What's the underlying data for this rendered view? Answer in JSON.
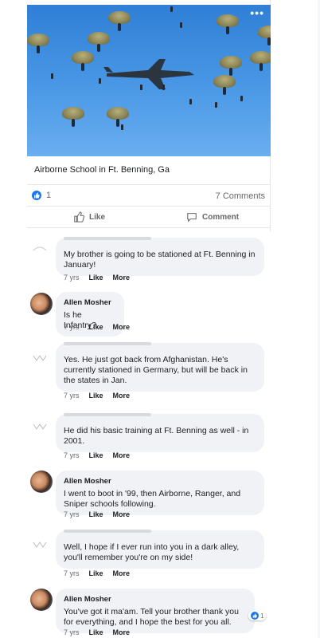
{
  "post": {
    "menu_glyph": "•••",
    "caption": "Airborne School in Ft. Benning, Ga",
    "like_count": "1",
    "comments_count": "7 Comments",
    "like_label": "Like",
    "comment_label": "Comment"
  },
  "comments": [
    {
      "author": "",
      "text": "My brother is going to be stationed at Ft. Benning in January!",
      "time": "7 yrs",
      "like": "Like",
      "more": "More"
    },
    {
      "author": "Allen Mosher",
      "text": "Is he Infantry?",
      "time": "7 yrs",
      "like": "Like",
      "more": "More"
    },
    {
      "author": "",
      "text": "Yes. He just got back from Afghanistan. He's currently stationed in Germany, but will be back in the states in Jan.",
      "time": "7 yrs",
      "like": "Like",
      "more": "More"
    },
    {
      "author": "",
      "text": "He did his basic training at Ft. Benning as well - in 2001.",
      "time": "7 yrs",
      "like": "Like",
      "more": "More"
    },
    {
      "author": "Allen Mosher",
      "text": "I went to boot in '99, then Airborne, Ranger, and Sniper schools following.",
      "time": "7 yrs",
      "like": "Like",
      "more": "More"
    },
    {
      "author": "",
      "text": "Well, I hope if I ever run into you in a dark alley, you'll remember you're on my side!",
      "time": "7 yrs",
      "like": "Like",
      "more": "More"
    },
    {
      "author": "Allen Mosher",
      "text": "You've got it ma'am. Tell your brother thank you for everything, and I hope the best for you all.",
      "time": "7 yrs",
      "like": "Like",
      "more": "More",
      "reaction_count": "1"
    }
  ],
  "colors": {
    "accent": "#1877f2",
    "bubble": "#f0f2f5",
    "muted": "#65676b"
  },
  "icons": [
    "thumbs-up-icon",
    "comment-icon",
    "more-options-icon"
  ]
}
